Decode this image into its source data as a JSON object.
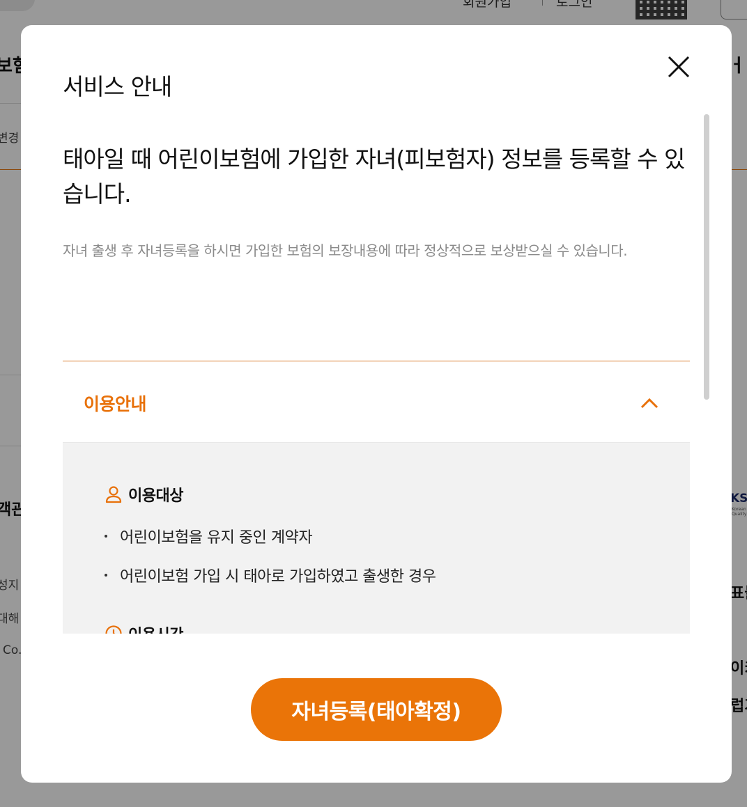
{
  "background": {
    "top_links": [
      "회원가입",
      "로그인"
    ],
    "left_fragments": [
      "보험",
      "변경",
      "객관",
      "성지",
      "대해",
      "Co."
    ],
    "right_fragments": [
      "ㅓ",
      "표들",
      "이키",
      "럽가"
    ],
    "badge_text": "KS",
    "badge_sub": "Korean Quality"
  },
  "modal": {
    "title": "서비스 안내",
    "close_label": "×",
    "headline": "태아일 때 어린이보험에 가입한 자녀(피보험자) 정보를 등록할 수 있습니다.",
    "description": "자녀 출생 후 자녀등록을 하시면 가입한 보험의 보장내용에 따라 정상적으로 보상받으실 수 있습니다.",
    "accordion": {
      "title": "이용안내",
      "expanded": true,
      "sections": [
        {
          "icon": "person-icon",
          "label": "이용대상",
          "items": [
            "어린이보험을 유지 중인 계약자",
            "어린이보험 가입 시 태아로 가입하였고 출생한 경우"
          ]
        },
        {
          "icon": "clock-icon",
          "label": "이용시간",
          "items": []
        }
      ]
    },
    "primary_button": "자녀등록(태아확정)"
  },
  "colors": {
    "accent": "#e8710a",
    "button": "#ea7408",
    "overlay": "rgba(0,0,0,0.4)",
    "panel_bg": "#f2f2f2"
  }
}
